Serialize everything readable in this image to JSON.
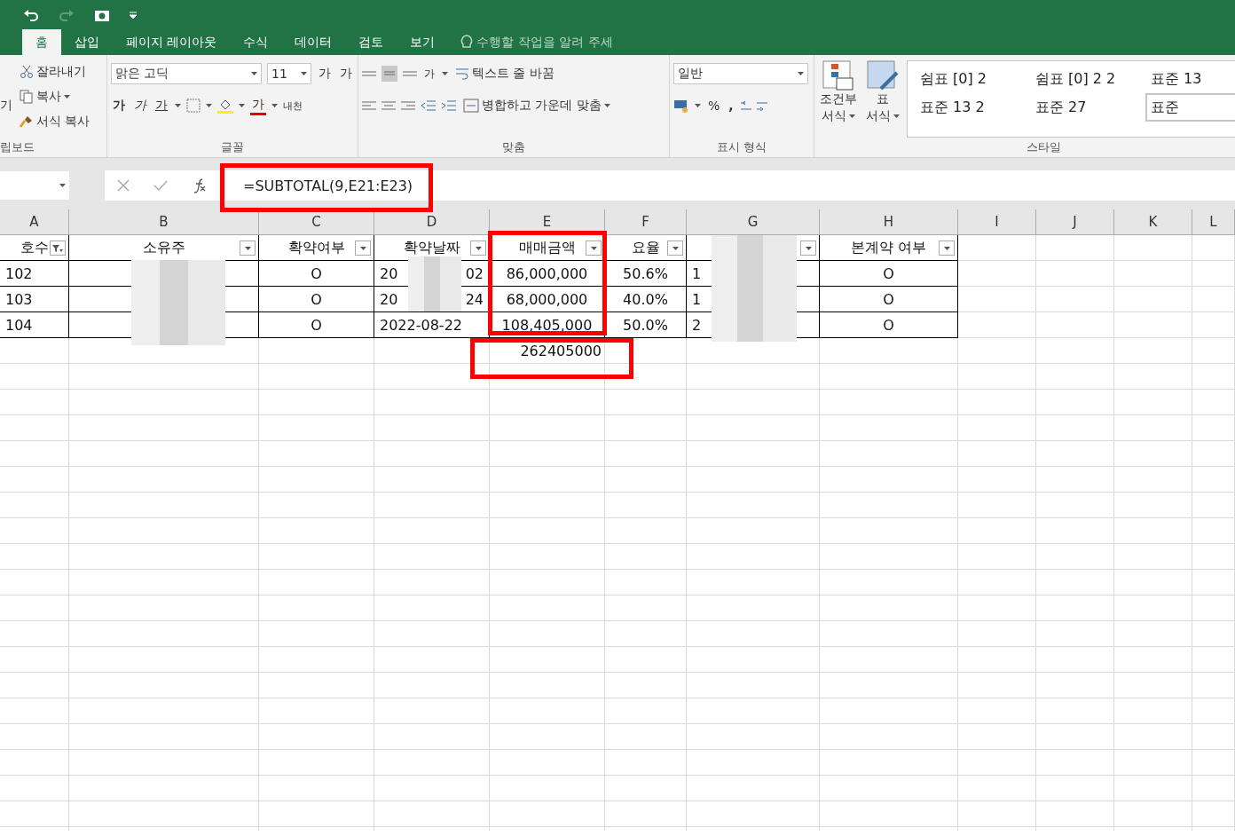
{
  "ribbon_tabs": [
    {
      "label": "홈",
      "selected": true
    },
    {
      "label": "삽입",
      "selected": false
    },
    {
      "label": "페이지 레이아웃",
      "selected": false
    },
    {
      "label": "수식",
      "selected": false
    },
    {
      "label": "데이터",
      "selected": false
    },
    {
      "label": "검토",
      "selected": false
    },
    {
      "label": "보기",
      "selected": false
    }
  ],
  "tell_me": {
    "placeholder": "수행할 작업을 알려 주세"
  },
  "clipboard": {
    "paste": "기",
    "cut": "잘라내기",
    "copy": "복사",
    "format_painter": "서식 복사",
    "group": "립보드"
  },
  "font": {
    "name": "맑은 고딕",
    "size": "11",
    "grow": "가",
    "shrink": "가",
    "bold": "가",
    "italic": "가",
    "underline": "가",
    "color_letter": "가",
    "phonetic": "내천",
    "group": "글꼴"
  },
  "alignment": {
    "wrap": "텍스트 줄 바꿈",
    "merge": "병합하고 가운데 맞춤",
    "orientation": "가",
    "group": "맞춤"
  },
  "number": {
    "format": "일반",
    "percent": "%",
    "comma": ",",
    "group": "표시 형식"
  },
  "styles": {
    "conditional": [
      "조건부",
      "서식"
    ],
    "table": [
      "표",
      "서식"
    ],
    "cells": [
      {
        "label": "쉼표 [0] 2",
        "selected": false
      },
      {
        "label": "쉼표 [0] 2 2",
        "selected": false
      },
      {
        "label": "표준 13",
        "selected": false
      },
      {
        "label": "표준 13 2",
        "selected": false
      },
      {
        "label": "표준 27",
        "selected": false
      },
      {
        "label": "표준",
        "selected": true
      }
    ],
    "group": "스타일"
  },
  "formula_bar": {
    "formula": "=SUBTOTAL(9,E21:E23)"
  },
  "sheet": {
    "columns": [
      "A",
      "B",
      "C",
      "D",
      "E",
      "F",
      "G",
      "H",
      "I",
      "J",
      "K",
      "L"
    ],
    "headers": [
      {
        "label": "호수",
        "filtered": true
      },
      {
        "label": "소유주",
        "filtered": false
      },
      {
        "label": "확약여부",
        "filtered": false
      },
      {
        "label": "확약날짜",
        "filtered": false
      },
      {
        "label": "매매금액",
        "filtered": false
      },
      {
        "label": "요율",
        "filtered": false
      },
      {
        "filtered": false
      },
      {
        "label": "본계약 여부",
        "filtered": false
      }
    ],
    "rows": [
      {
        "unit": "102",
        "status": "O",
        "date": "20",
        "date_tail": "02",
        "price": "86,000,000",
        "rate": "50.6%",
        "g": "1",
        "contract": "O"
      },
      {
        "unit": "103",
        "status": "O",
        "date": "20",
        "date_tail": "24",
        "price": "68,000,000",
        "rate": "40.0%",
        "g": "1",
        "contract": "O"
      },
      {
        "unit": "104",
        "status": "O",
        "date": "2022-08-22",
        "price": "108,405,000",
        "rate": "50.0%",
        "g": "2",
        "contract": "O"
      }
    ],
    "subtotal": "262405000"
  }
}
